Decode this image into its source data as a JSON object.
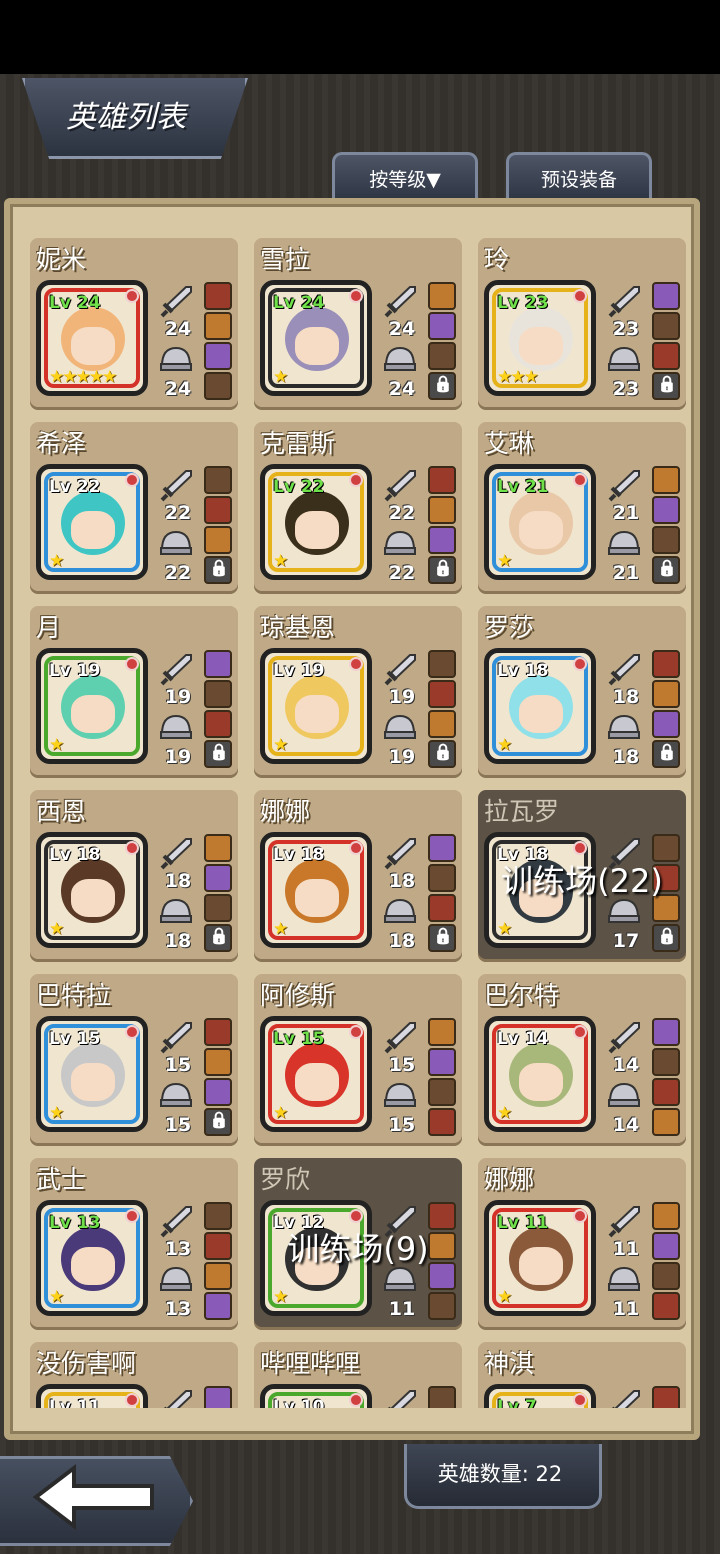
{
  "header": {
    "title": "英雄列表"
  },
  "tabs": {
    "sort": "按等级▼",
    "preset": "预设装备"
  },
  "footer": {
    "hero_count": "英雄数量: 22"
  },
  "heroes": [
    {
      "name": "妮米",
      "lv": "Lv 24",
      "atk": "24",
      "def": "24",
      "stars": "★★★★★",
      "green": true,
      "ring": "#d43228",
      "hair": "#f1b57a"
    },
    {
      "name": "雪拉",
      "lv": "Lv 24",
      "atk": "24",
      "def": "24",
      "stars": "★",
      "green": true,
      "ring": "#2b2b2b",
      "hair": "#9a8fb8"
    },
    {
      "name": "玲",
      "lv": "Lv 23",
      "atk": "23",
      "def": "23",
      "stars": "★★★",
      "green": true,
      "ring": "#e6b21a",
      "hair": "#e8e4dc"
    },
    {
      "name": "希泽",
      "lv": "Lv 22",
      "atk": "22",
      "def": "22",
      "stars": "★",
      "green": false,
      "ring": "#2f8fd8",
      "hair": "#3fc6c4"
    },
    {
      "name": "克雷斯",
      "lv": "Lv 22",
      "atk": "22",
      "def": "22",
      "stars": "★",
      "green": true,
      "ring": "#e6b21a",
      "hair": "#3a2f1a"
    },
    {
      "name": "艾琳",
      "lv": "Lv 21",
      "atk": "21",
      "def": "21",
      "stars": "★",
      "green": true,
      "ring": "#2f8fd8",
      "hair": "#e9c8a8"
    },
    {
      "name": "月",
      "lv": "Lv 19",
      "atk": "19",
      "def": "19",
      "stars": "★",
      "green": false,
      "ring": "#4aa82c",
      "hair": "#5ed0b0"
    },
    {
      "name": "琼基恩",
      "lv": "Lv 19",
      "atk": "19",
      "def": "19",
      "stars": "★",
      "green": false,
      "ring": "#e6b21a",
      "hair": "#f0c860"
    },
    {
      "name": "罗莎",
      "lv": "Lv 18",
      "atk": "18",
      "def": "18",
      "stars": "★",
      "green": false,
      "ring": "#2f8fd8",
      "hair": "#8fe0e8"
    },
    {
      "name": "西恩",
      "lv": "Lv 18",
      "atk": "18",
      "def": "18",
      "stars": "★",
      "green": false,
      "ring": "#2b2b2b",
      "hair": "#5a3a26"
    },
    {
      "name": "娜娜",
      "lv": "Lv 18",
      "atk": "18",
      "def": "18",
      "stars": "★",
      "green": false,
      "ring": "#d43228",
      "hair": "#c9782a"
    },
    {
      "name": "拉瓦罗",
      "lv": "Lv 18",
      "atk": "",
      "def": "17",
      "stars": "★",
      "green": false,
      "ring": "#2b2b2b",
      "hair": "#303a40",
      "overlay": "训练场(22)"
    },
    {
      "name": "巴特拉",
      "lv": "Lv 15",
      "atk": "15",
      "def": "15",
      "stars": "★",
      "green": false,
      "ring": "#2f8fd8",
      "hair": "#c8c8c8"
    },
    {
      "name": "阿修斯",
      "lv": "Lv 15",
      "atk": "15",
      "def": "15",
      "stars": "★",
      "green": true,
      "ring": "#d43228",
      "hair": "#d8342a"
    },
    {
      "name": "巴尔特",
      "lv": "Lv 14",
      "atk": "14",
      "def": "14",
      "stars": "★",
      "green": false,
      "ring": "#d43228",
      "hair": "#a8b87a"
    },
    {
      "name": "武士",
      "lv": "Lv 13",
      "atk": "13",
      "def": "13",
      "stars": "★",
      "green": true,
      "ring": "#2f8fd8",
      "hair": "#4a3a7a"
    },
    {
      "name": "罗欣",
      "lv": "Lv 12",
      "atk": "",
      "def": "11",
      "stars": "★",
      "green": false,
      "ring": "#4aa82c",
      "hair": "#303030",
      "overlay": "训练场(9)"
    },
    {
      "name": "娜娜",
      "lv": "Lv 11",
      "atk": "11",
      "def": "11",
      "stars": "★",
      "green": true,
      "ring": "#d43228",
      "hair": "#8a5a3a"
    },
    {
      "name": "没伤害啊",
      "lv": "Lv 11",
      "atk": "",
      "def": "",
      "stars": "",
      "green": false,
      "ring": "#e6b21a",
      "hair": "#e0b070"
    },
    {
      "name": "哔哩哔哩",
      "lv": "Lv 10",
      "atk": "",
      "def": "",
      "stars": "",
      "green": false,
      "ring": "#4aa82c",
      "hair": "#303030"
    },
    {
      "name": "神淇",
      "lv": "Lv 7",
      "atk": "",
      "def": "",
      "stars": "",
      "green": true,
      "ring": "#e6b21a",
      "hair": "#f0d060"
    }
  ]
}
